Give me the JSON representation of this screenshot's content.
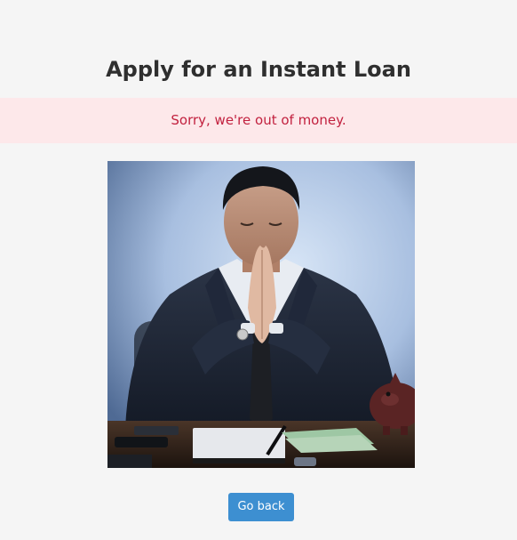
{
  "page": {
    "title": "Apply for an Instant Loan"
  },
  "alert": {
    "message": "Sorry, we're out of money."
  },
  "image": {
    "subject": "man-in-suit-praying-at-desk-photo"
  },
  "actions": {
    "back_label": "Go back"
  },
  "colors": {
    "background": "#f5f5f5",
    "alert_background": "#fde8ea",
    "alert_text": "#c2213f",
    "button": "#3d8fd1"
  }
}
